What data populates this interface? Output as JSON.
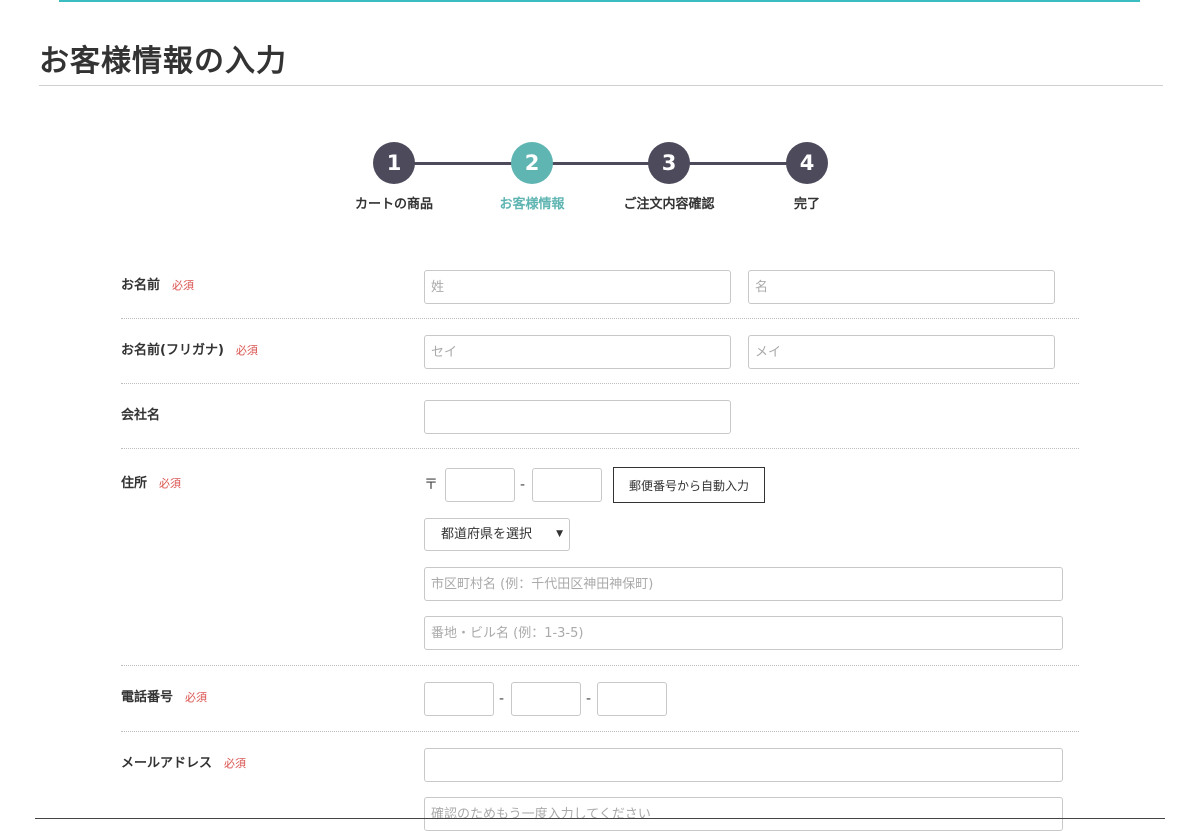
{
  "page": {
    "title": "お客様情報の入力"
  },
  "steps": [
    {
      "num": "1",
      "label": "カートの商品"
    },
    {
      "num": "2",
      "label": "お客様情報"
    },
    {
      "num": "3",
      "label": "ご注文内容確認"
    },
    {
      "num": "4",
      "label": "完了"
    }
  ],
  "colors": {
    "accent": "#5fb5b2",
    "step_dark": "#4d4a5c",
    "required": "#d9534f"
  },
  "form": {
    "required_label": "必須",
    "name": {
      "label": "お名前",
      "last_placeholder": "姓",
      "first_placeholder": "名"
    },
    "kana": {
      "label": "お名前(フリガナ)",
      "last_placeholder": "セイ",
      "first_placeholder": "メイ"
    },
    "company": {
      "label": "会社名"
    },
    "address": {
      "label": "住所",
      "postal_mark": "〒",
      "dash": "-",
      "zip_button": "郵便番号から自動入力",
      "prefecture_selected": "都道府県を選択",
      "city_placeholder": "市区町村名 (例：千代田区神田神保町)",
      "street_placeholder": "番地・ビル名 (例：1-3-5)"
    },
    "phone": {
      "label": "電話番号",
      "dash": "-"
    },
    "email": {
      "label": "メールアドレス",
      "confirm_placeholder": "確認のためもう一度入力してください"
    }
  }
}
